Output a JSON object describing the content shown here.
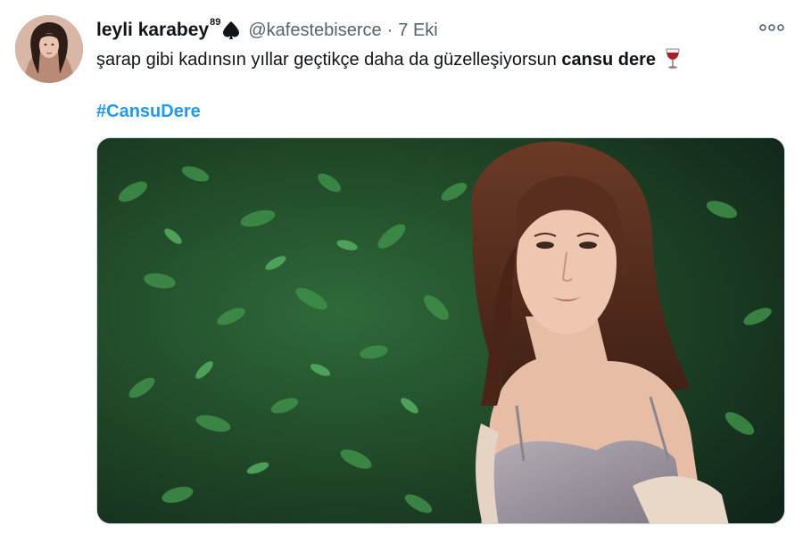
{
  "tweet": {
    "author": {
      "display_name": "leyli karabey",
      "name_superscript": "89",
      "badge_icon": "spade-icon",
      "handle": "@kafestebiserce",
      "avatar_icon": "avatar-photo"
    },
    "separator": "·",
    "date": "7 Eki",
    "more_icon": "more-options-icon",
    "text": {
      "plain": "şarap gibi kadınsın yıllar geçtikçe daha da güzelleşiyorsun ",
      "bold": "cansu dere",
      "emoji_icon": "wine-glass-icon"
    },
    "hashtag": "#CansuDere",
    "media": {
      "icon": "photo-woman-in-garden"
    }
  },
  "colors": {
    "text_primary": "#0f1419",
    "text_secondary": "#536471",
    "link": "#1d9bf0"
  }
}
